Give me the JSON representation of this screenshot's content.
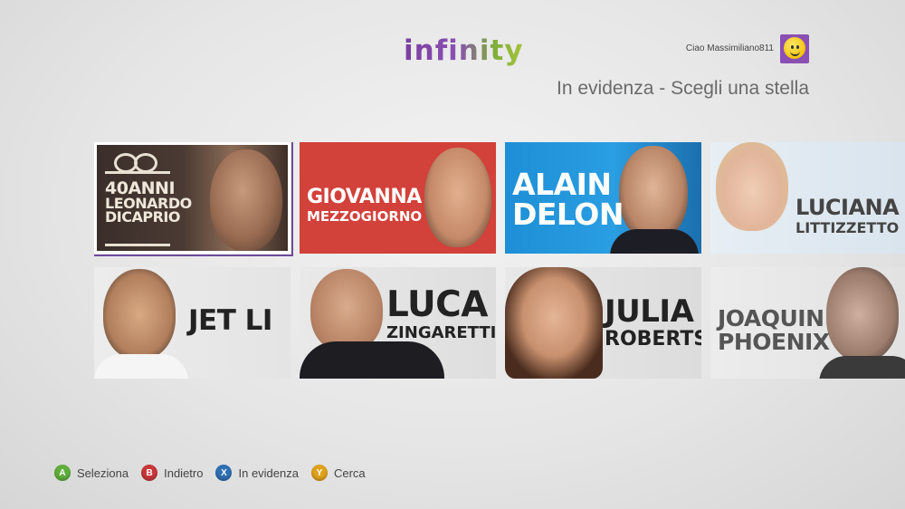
{
  "header": {
    "logo": "infinity",
    "greeting": "Ciao Massimiliano811",
    "page_title": "In evidenza - Scegli una stella"
  },
  "tiles": [
    {
      "line1": "40ANNI",
      "line2": "LEONARDO",
      "line3": "DICAPRIO",
      "selected": true
    },
    {
      "line1": "GIOVANNA",
      "line2": "MEZZOGIORNO"
    },
    {
      "line1": "ALAIN",
      "line2": "DELON"
    },
    {
      "line1": "LUCIANA",
      "line2": "LITTIZZETTO"
    },
    {
      "line1": "JET LI"
    },
    {
      "line1": "LUCA",
      "line2": "ZINGARETTI"
    },
    {
      "line1": "JULIA",
      "line2": "ROBERTS"
    },
    {
      "line1": "JOAQUIN",
      "line2": "PHOENIX"
    }
  ],
  "legend": [
    {
      "key": "A",
      "label": "Seleziona",
      "color": "#5fae3c"
    },
    {
      "key": "B",
      "label": "Indietro",
      "color": "#c8373a"
    },
    {
      "key": "X",
      "label": "In evidenza",
      "color": "#2f6fb3"
    },
    {
      "key": "Y",
      "label": "Cerca",
      "color": "#e0a21c"
    }
  ],
  "colors": {
    "accent_purple": "#7b3fa0",
    "selection_border": "#6d4a9a"
  }
}
